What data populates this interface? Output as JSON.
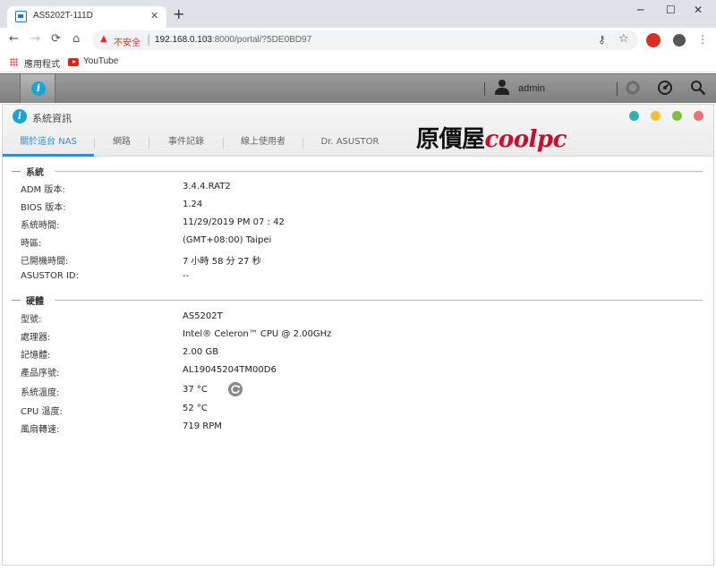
{
  "browser": {
    "tab_title": "AS5202T-111D",
    "new_tab": "+",
    "window_controls": {
      "minimize": "─",
      "maximize": "☐",
      "close": "✕"
    },
    "nav": {
      "back": "←",
      "forward": "→",
      "reload": "⟳",
      "home": "⌂"
    },
    "security_warning": "不安全",
    "url_host": "192.168.0.103",
    "url_rest": ":8000/portal/?5DE0BD97",
    "bookmarks": [
      {
        "label": "應用程式",
        "icon": "apps-grid-icon"
      },
      {
        "label": "YouTube",
        "icon": "youtube-icon"
      }
    ]
  },
  "taskbar": {
    "username": "admin",
    "icons": [
      "info-app-icon",
      "user-icon",
      "notification-icon",
      "dashboard-icon",
      "search-icon"
    ]
  },
  "window": {
    "title": "系統資訊",
    "tabs": [
      {
        "label": "關於這台 NAS",
        "active": true
      },
      {
        "label": "網路"
      },
      {
        "label": "事件記錄"
      },
      {
        "label": "線上使用者"
      },
      {
        "label": "Dr. ASUSTOR"
      }
    ],
    "watermark": {
      "cjk": "原價屋",
      "latin": "coolpc"
    },
    "dot_colors": [
      "#2bb3b1",
      "#f2c12e",
      "#7cc142",
      "#f26d6d"
    ]
  },
  "system": {
    "title": "系統",
    "rows": [
      {
        "label": "ADM 版本:",
        "value": "3.4.4.RAT2"
      },
      {
        "label": "BIOS 版本:",
        "value": "1.24"
      },
      {
        "label": "系統時間:",
        "value": "11/29/2019  PM 07 : 42"
      },
      {
        "label": "時區:",
        "value": "(GMT+08:00) Taipei"
      },
      {
        "label": "已開機時間:",
        "value": "7 小時 58 分 27 秒"
      },
      {
        "label": "ASUSTOR ID:",
        "value": "--"
      }
    ]
  },
  "hardware": {
    "title": "硬體",
    "rows": [
      {
        "label": "型號:",
        "value": "AS5202T"
      },
      {
        "label": "處理器:",
        "value": "Intel® Celeron™ CPU @ 2.00GHz"
      },
      {
        "label": "記憶體:",
        "value": "2.00 GB"
      },
      {
        "label": "產品序號:",
        "value": "AL19045204TM00D6"
      },
      {
        "label": "系統溫度:",
        "value": "37 °C"
      },
      {
        "label": "CPU 溫度:",
        "value": "52 °C"
      },
      {
        "label": "風扇轉速:",
        "value": "719 RPM"
      }
    ]
  }
}
